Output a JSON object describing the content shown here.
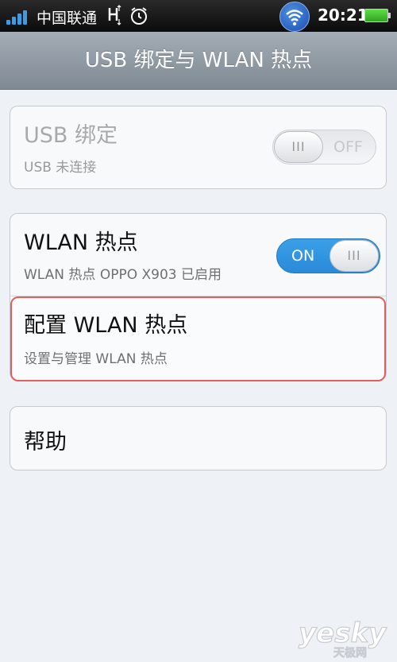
{
  "status_bar": {
    "carrier": "中国联通",
    "time": "20:21",
    "icons": [
      "signal-icon",
      "h-network-icon",
      "alarm-icon",
      "wifi-hotspot-icon",
      "battery-icon"
    ]
  },
  "title": "USB 绑定与 WLAN 热点",
  "usb_tethering": {
    "title": "USB 绑定",
    "summary": "USB 未连接",
    "toggle_label": "OFF",
    "knob_grip": "III",
    "enabled": false
  },
  "wlan_hotspot": {
    "title": "WLAN 热点",
    "summary": "WLAN 热点 OPPO X903 已启用",
    "toggle_label": "ON",
    "knob_grip": "III",
    "enabled": true
  },
  "configure_hotspot": {
    "title": "配置 WLAN 热点",
    "summary": "设置与管理 WLAN 热点"
  },
  "help": {
    "title": "帮助"
  },
  "watermark": {
    "text": "yesky",
    "subtext": "天极网"
  },
  "colors": {
    "accent_toggle_on": "#2a8ad8",
    "selection_border": "#e06060",
    "title_bar": "#8d969f"
  }
}
